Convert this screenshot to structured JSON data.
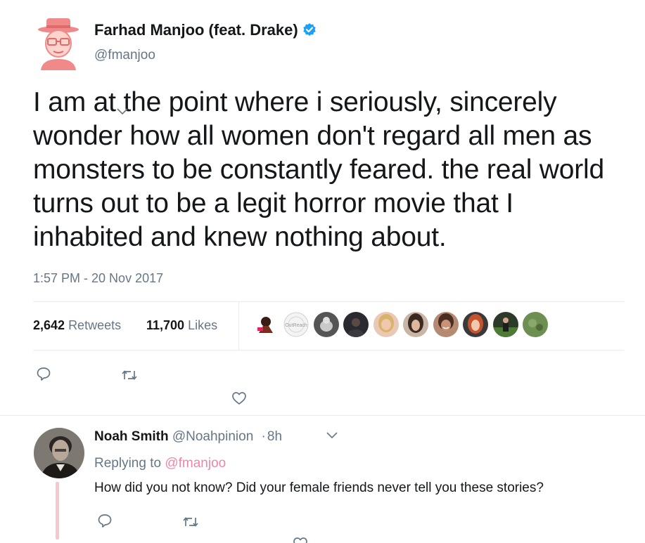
{
  "tweet": {
    "author_name": "Farhad Manjoo (feat. Drake)",
    "author_handle": "@fmanjoo",
    "verified": true,
    "text": "I am at the point where i seriously, sincerely wonder how all women don't regard all men as monsters to be constantly feared. the real world turns out to be a legit horror movie that I inhabited and knew nothing about.",
    "timestamp": "1:57 PM - 20 Nov 2017",
    "retweets_count": "2,642",
    "retweets_label": "Retweets",
    "likes_count": "11,700",
    "likes_label": "Likes",
    "likers": [
      {
        "icon": "illustrated-figure-avatar",
        "color": "#7a2d1c"
      },
      {
        "icon": "outreach-logo-avatar",
        "label": "OutReach",
        "color": "#e8e8e8"
      },
      {
        "icon": "pet-photo-avatar",
        "color": "#4a4a4a"
      },
      {
        "icon": "dark-photo-avatar",
        "color": "#2a2a30"
      },
      {
        "icon": "blonde-person-avatar",
        "color": "#d9a68a"
      },
      {
        "icon": "dark-hair-person-avatar",
        "color": "#6b4b3a"
      },
      {
        "icon": "smiling-person-avatar",
        "color": "#a0694f"
      },
      {
        "icon": "red-hair-person-avatar",
        "color": "#c4532e"
      },
      {
        "icon": "sports-photo-avatar",
        "color": "#3b5a2c"
      },
      {
        "icon": "grass-photo-avatar",
        "color": "#5c7a44"
      }
    ],
    "actions": [
      "reply-icon",
      "retweet-icon",
      "like-icon"
    ]
  },
  "reply": {
    "author_name": "Noah Smith",
    "author_handle": "@Noahpinion",
    "separator": "·",
    "time": "8h",
    "replying_prefix": "Replying to",
    "replying_handle": "@fmanjoo",
    "text": "How did you not know? Did your female friends never tell you these stories?",
    "actions": [
      "reply-icon",
      "retweet-icon",
      "like-icon"
    ]
  },
  "colors": {
    "primary_text": "#14171a",
    "secondary_text": "#657786",
    "verified_blue": "#1da1f2",
    "divider": "#e6ecf0",
    "thread_line": "#f8c6d0",
    "reply_link": "#e0245e"
  }
}
